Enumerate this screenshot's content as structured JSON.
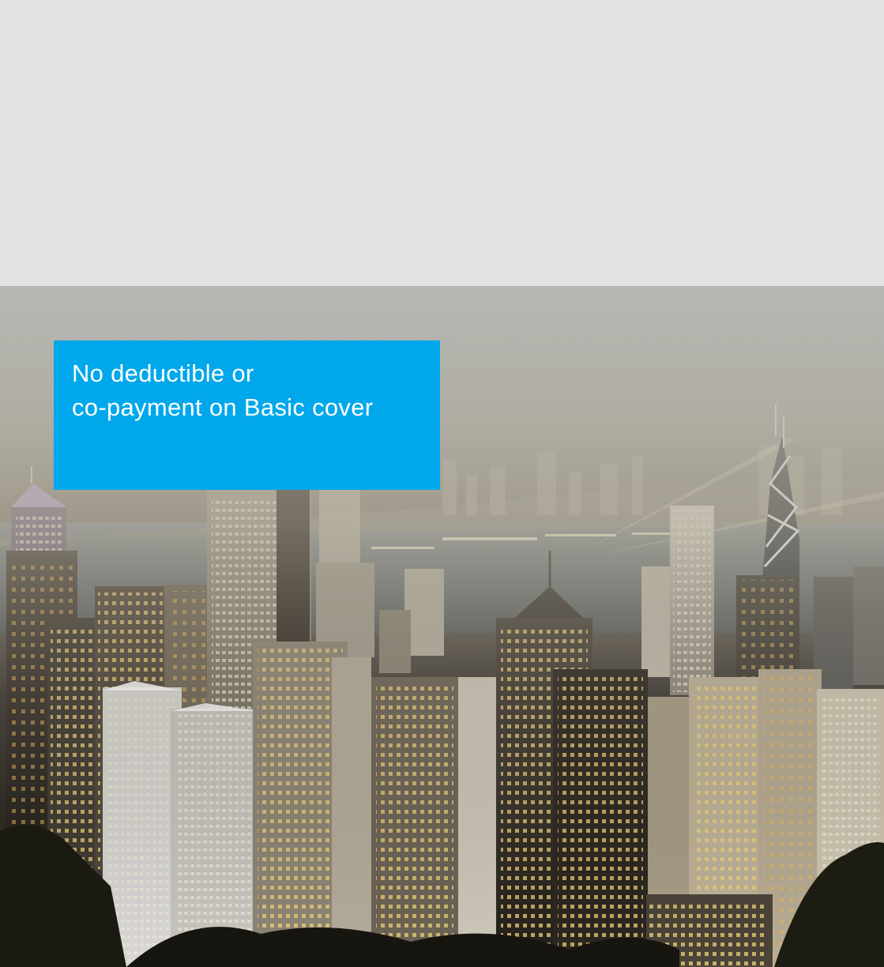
{
  "callout": {
    "line1": "No deductible or",
    "line2": "co-payment on Basic cover"
  },
  "colors": {
    "background": "#e3e3e4",
    "callout_bg": "#00a8eb",
    "callout_text": "#ffffff"
  },
  "hero_image": {
    "subject": "city-skyline-night"
  }
}
